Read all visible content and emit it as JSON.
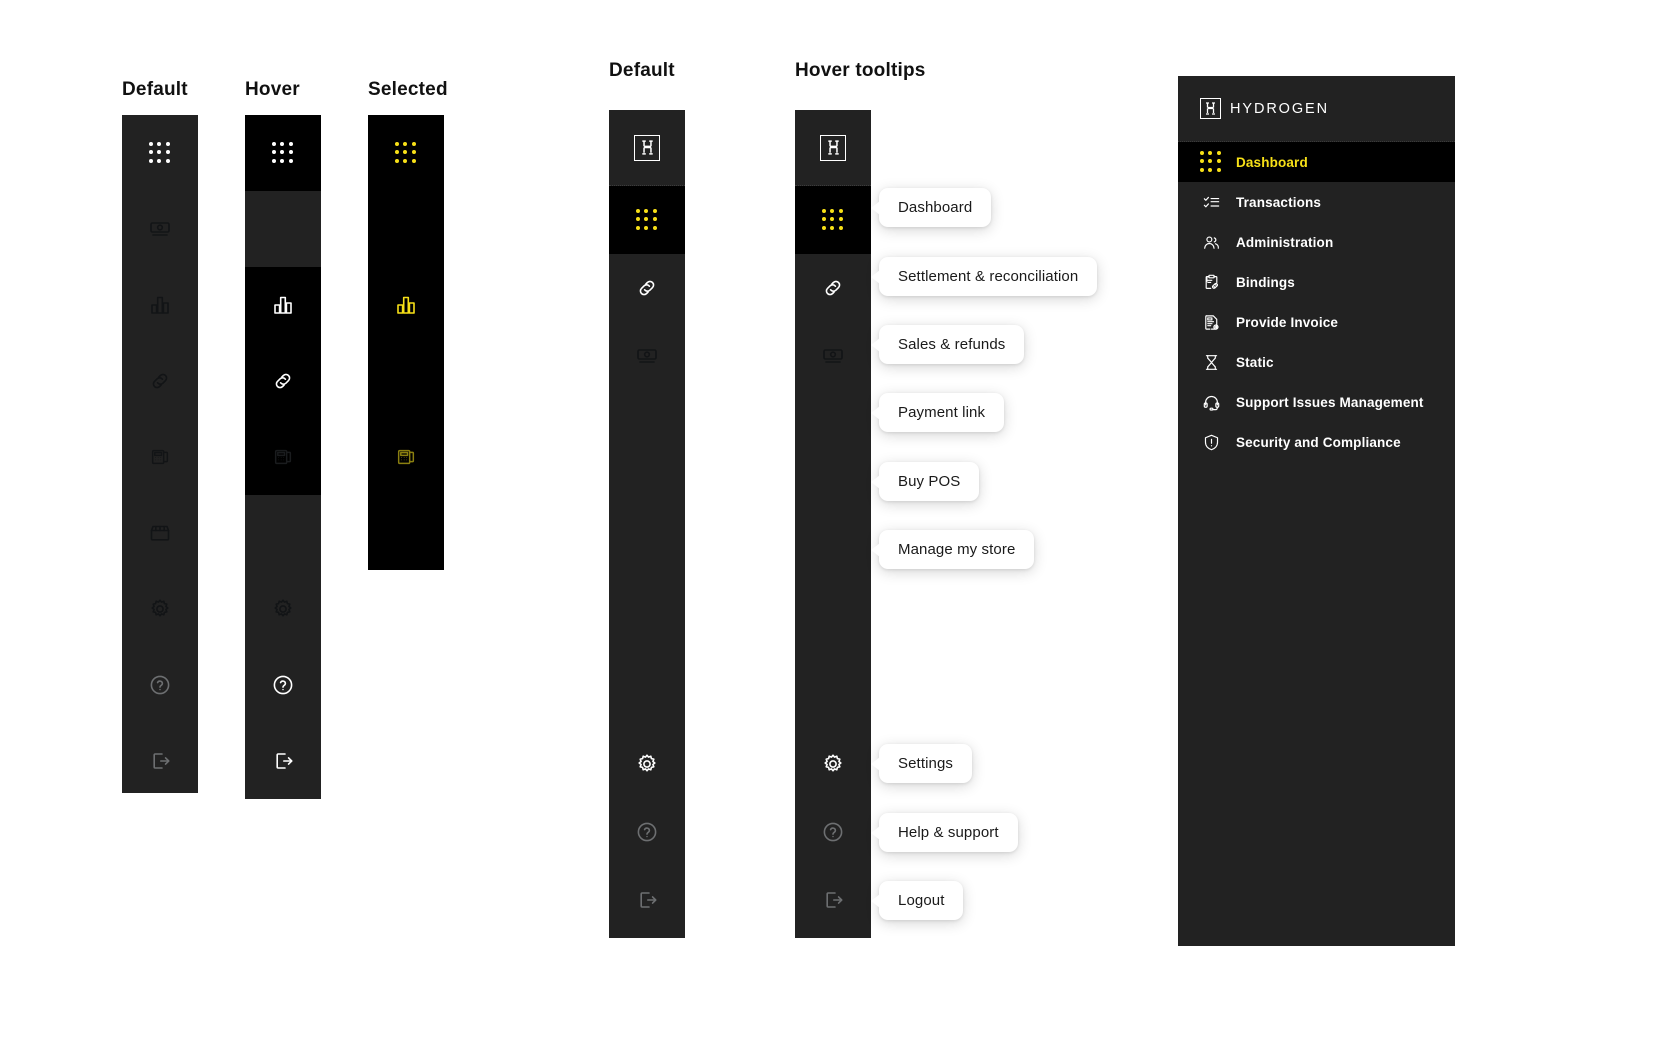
{
  "columns": {
    "default_states": "Default",
    "hover_states": "Hover",
    "selected_states": "Selected",
    "default_rail": "Default",
    "hover_tooltips": "Hover tooltips"
  },
  "colors": {
    "rail_default": "#222222",
    "rail_active": "#000000",
    "accent_yellow": "#F7E017",
    "icon_white": "#FFFFFF",
    "tooltip_bg": "#FFFFFF",
    "page_bg": "#FFFFFF"
  },
  "state_rail_icons": [
    {
      "name": "dashboard",
      "icon": "grid-dots-icon"
    },
    {
      "name": "sales-refunds",
      "icon": "cash-note-icon"
    },
    {
      "name": "reports",
      "icon": "bar-chart-icon"
    },
    {
      "name": "payment-link",
      "icon": "link-chain-icon"
    },
    {
      "name": "buy-pos",
      "icon": "pos-terminal-icon"
    },
    {
      "name": "manage-my-store",
      "icon": "storefront-icon"
    },
    {
      "name": "settings",
      "icon": "gear-icon"
    },
    {
      "name": "help-support",
      "icon": "question-circle-icon"
    },
    {
      "name": "logout",
      "icon": "logout-arrow-icon"
    }
  ],
  "collapsed_rail": {
    "logo": "hydrogen-logo-mark",
    "items": [
      {
        "label": "Dashboard",
        "icon": "grid-dots-icon",
        "selected": true
      },
      {
        "label": "Settlement & reconciliation",
        "icon": "link-chain-icon",
        "selected": false
      },
      {
        "label": "Sales & refunds",
        "icon": "cash-note-icon",
        "selected": false
      },
      {
        "label": "Payment link",
        "icon": "link-chain-icon",
        "selected": false
      },
      {
        "label": "Buy POS",
        "icon": "pos-terminal-icon",
        "selected": false
      },
      {
        "label": "Manage my store",
        "icon": "storefront-icon",
        "selected": false
      },
      {
        "label": "Settings",
        "icon": "gear-icon",
        "selected": false
      },
      {
        "label": "Help & support",
        "icon": "question-circle-icon",
        "selected": false
      },
      {
        "label": "Logout",
        "icon": "logout-arrow-icon",
        "selected": false
      }
    ]
  },
  "panel": {
    "brand": "HYDROGEN",
    "brand_mark": "H",
    "items": [
      {
        "label": "Dashboard",
        "icon": "grid-dots-icon",
        "selected": true
      },
      {
        "label": "Transactions",
        "icon": "checklist-icon",
        "selected": false
      },
      {
        "label": "Administration",
        "icon": "users-icon",
        "selected": false
      },
      {
        "label": "Bindings",
        "icon": "clipboard-link-icon",
        "selected": false
      },
      {
        "label": "Provide Invoice",
        "icon": "invoice-document-icon",
        "selected": false
      },
      {
        "label": "Static",
        "icon": "hourglass-icon",
        "selected": false
      },
      {
        "label": "Support Issues Management",
        "icon": "headset-icon",
        "selected": false
      },
      {
        "label": "Security and Compliance",
        "icon": "shield-alert-icon",
        "selected": false
      }
    ]
  }
}
